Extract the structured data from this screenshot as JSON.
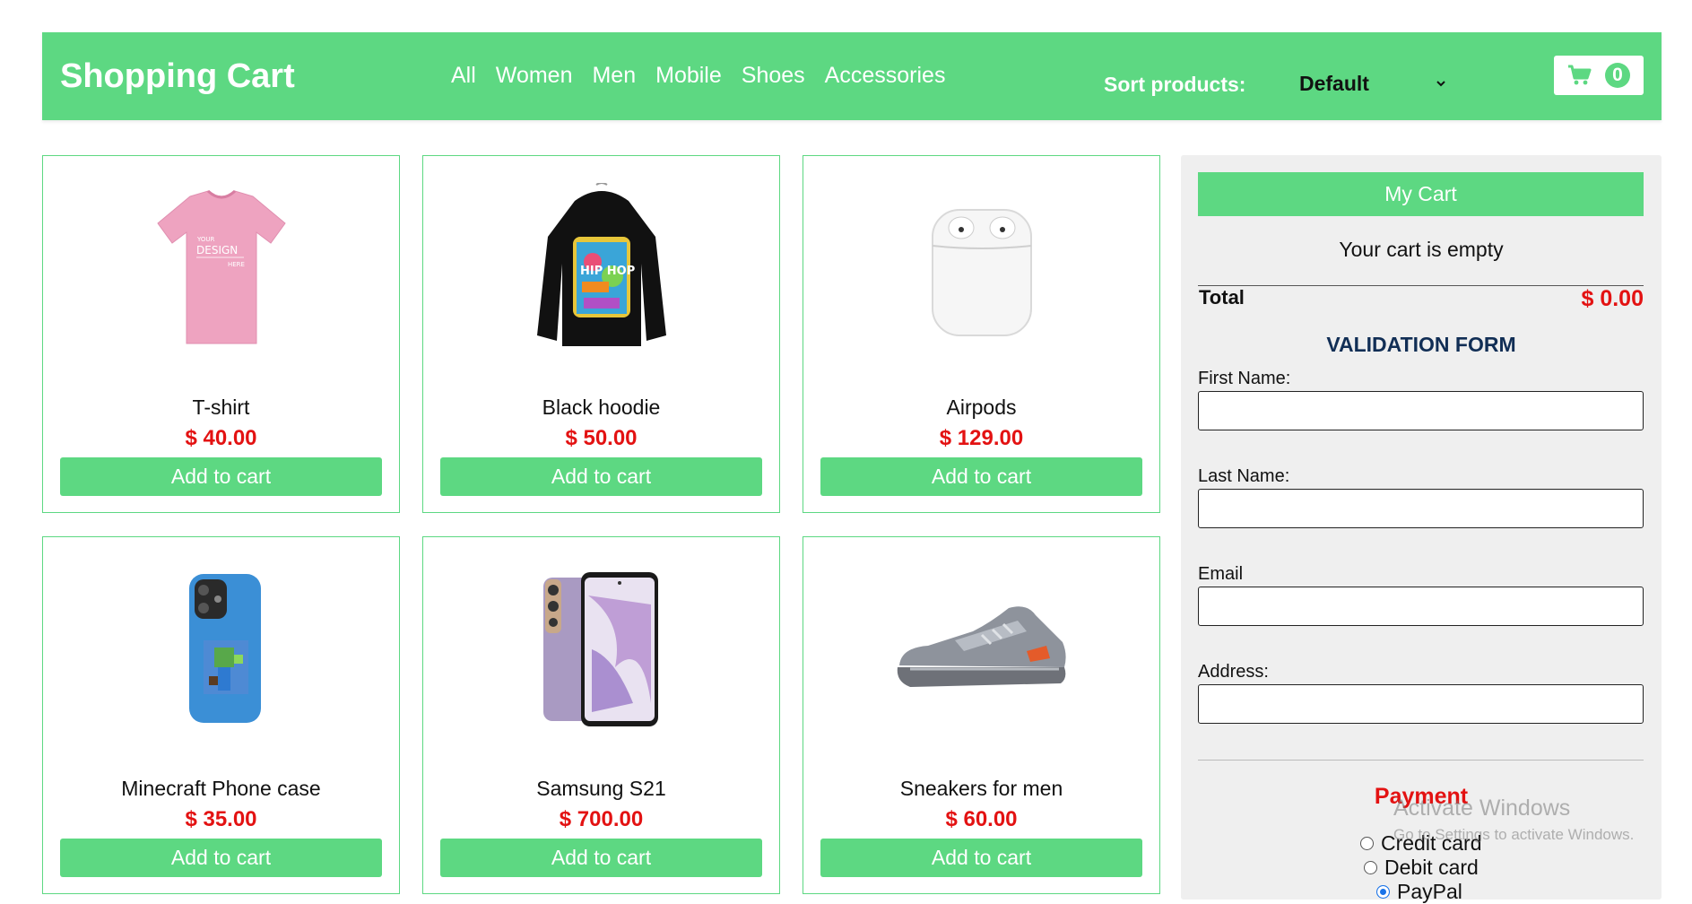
{
  "header": {
    "title": "Shopping Cart",
    "nav": [
      "All",
      "Women",
      "Men",
      "Mobile",
      "Shoes",
      "Accessories"
    ],
    "sort_label": "Sort products:",
    "sort_value": "Default",
    "cart_count": "0"
  },
  "products": [
    {
      "name": "T-shirt",
      "price": "$ 40.00",
      "button": "Add to cart",
      "icon": "tshirt-image"
    },
    {
      "name": "Black hoodie",
      "price": "$ 50.00",
      "button": "Add to cart",
      "icon": "hoodie-image"
    },
    {
      "name": "Airpods",
      "price": "$ 129.00",
      "button": "Add to cart",
      "icon": "airpods-image"
    },
    {
      "name": "Minecraft Phone case",
      "price": "$ 35.00",
      "button": "Add to cart",
      "icon": "phone-case-image"
    },
    {
      "name": "Samsung S21",
      "price": "$ 700.00",
      "button": "Add to cart",
      "icon": "smartphone-image"
    },
    {
      "name": "Sneakers for men",
      "price": "$ 60.00",
      "button": "Add to cart",
      "icon": "sneaker-image"
    }
  ],
  "sidebar": {
    "my_cart": "My Cart",
    "empty_message": "Your cart is empty",
    "total_label": "Total",
    "total_value": "$ 0.00",
    "form_title": "VALIDATION FORM",
    "fields": [
      {
        "label": "First Name:",
        "value": ""
      },
      {
        "label": "Last Name:",
        "value": ""
      },
      {
        "label": "Email",
        "value": ""
      },
      {
        "label": "Address:",
        "value": ""
      }
    ],
    "payment_title": "Payment",
    "payment_options": [
      "Credit card",
      "Debit card",
      "PayPal"
    ],
    "payment_selected": "PayPal"
  },
  "watermark": {
    "title": "Activate Windows",
    "subtitle": "Go to Settings to activate Windows."
  },
  "colors": {
    "accent": "#5dd882",
    "price": "#e31212",
    "form_title": "#112e55",
    "sidebar_bg": "#efefef"
  }
}
